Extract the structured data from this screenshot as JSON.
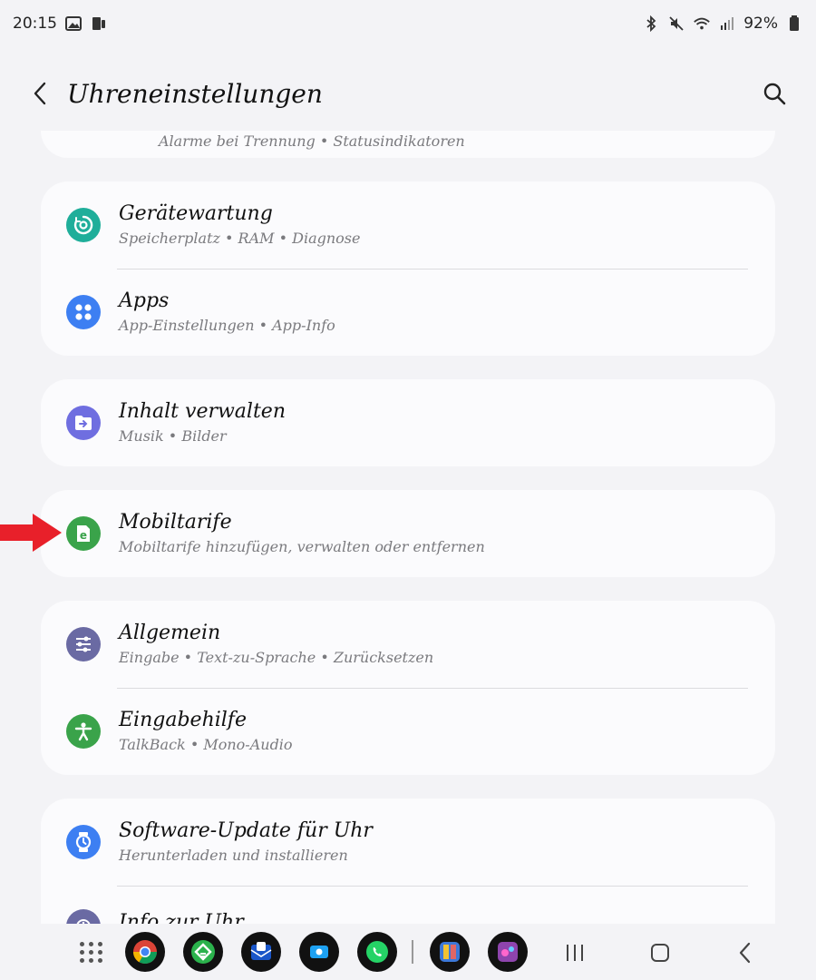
{
  "status_bar": {
    "time": "20:15",
    "battery": "92%"
  },
  "header": {
    "title": "Uhreneinstellungen"
  },
  "partial_item": {
    "subtitle": "Alarme bei Trennung • Statusindikatoren"
  },
  "groups": [
    {
      "items": [
        {
          "title": "Gerätewartung",
          "subtitle": "Speicherplatz • RAM • Diagnose",
          "icon": "device-care-icon",
          "color": "#1fae9a"
        },
        {
          "title": "Apps",
          "subtitle": "App-Einstellungen • App-Info",
          "icon": "apps-icon",
          "color": "#3d7ff2"
        }
      ]
    },
    {
      "items": [
        {
          "title": "Inhalt verwalten",
          "subtitle": "Musik • Bilder",
          "icon": "folder-transfer-icon",
          "color": "#6f6ee0"
        }
      ]
    },
    {
      "items": [
        {
          "title": "Mobiltarife",
          "subtitle": "Mobiltarife hinzufügen, verwalten oder entfernen",
          "icon": "esim-icon",
          "color": "#3aa34a"
        }
      ]
    },
    {
      "items": [
        {
          "title": "Allgemein",
          "subtitle": "Eingabe • Text-zu-Sprache • Zurücksetzen",
          "icon": "sliders-icon",
          "color": "#6a6aa3"
        },
        {
          "title": "Eingabehilfe",
          "subtitle": "TalkBack • Mono-Audio",
          "icon": "accessibility-icon",
          "color": "#3aa34a"
        }
      ]
    },
    {
      "items": [
        {
          "title": "Software-Update für Uhr",
          "subtitle": "Herunterladen und installieren",
          "icon": "software-update-icon",
          "color": "#3d7ff2"
        },
        {
          "title": "Info zur Uhr",
          "subtitle": "",
          "icon": "watch-info-icon",
          "color": "#6a6aa3"
        }
      ]
    }
  ],
  "colors": {
    "background": "#f3f3f6",
    "card": "#fbfbfd",
    "annotation_arrow": "#e8202a"
  }
}
